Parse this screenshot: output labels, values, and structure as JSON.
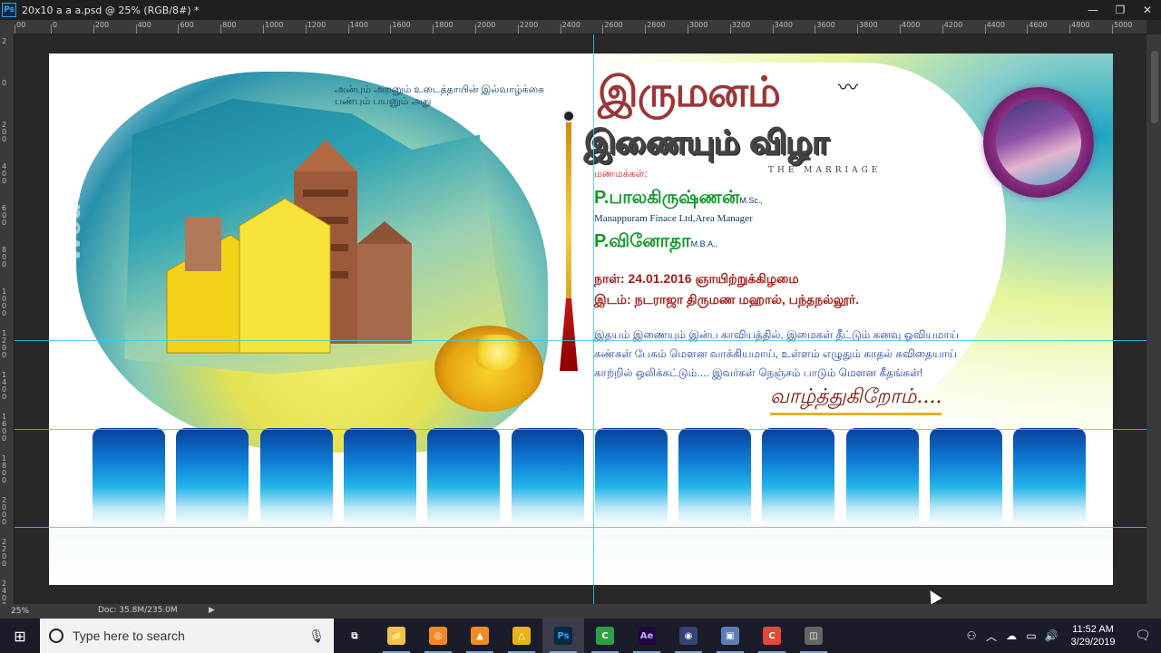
{
  "window": {
    "title": "20x10  a a a.psd @ 25% (RGB/8#) *",
    "app_icon": "Ps",
    "controls": [
      "—",
      "❐",
      "✕"
    ]
  },
  "ruler": {
    "top_labels": [
      "00",
      "0",
      "200",
      "400",
      "600",
      "800",
      "1000",
      "1200",
      "1400",
      "1600",
      "1800",
      "2000",
      "2200",
      "2400",
      "2600",
      "2800",
      "3000",
      "3200",
      "3400",
      "3600",
      "3800",
      "4000",
      "4200",
      "4400",
      "4600",
      "4800",
      "5000"
    ],
    "left_labels": [
      "2",
      "0",
      "2 0 0",
      "4 0 0",
      "6 0 0",
      "8 0 0",
      "1 0 0 0",
      "1 2 0 0",
      "1 4 0 0",
      "1 6 0 0",
      "1 8 0 0",
      "2 0 0 0",
      "2 2 0 0",
      "2 4 0 0"
    ]
  },
  "artwork": {
    "quote_line1": "அன்பும் அறனும் உடைத்தாயின் இல்வாழ்க்கை",
    "quote_line2": "பண்பும் பயனும் அது",
    "side_text": "Wedding WISHES",
    "title_back": "இருமனம்",
    "title_main": "இணையும் விழா",
    "subtitle": "THE MARRIAGE",
    "couple_label": "மணமக்கள்:",
    "groom_name": "P.பாலகிருஷ்ணன்",
    "groom_degree": "M.Sc.,",
    "groom_job": "Manappuram Finace Ltd,Area Manager",
    "bride_name": "P.வினோதா",
    "bride_degree": "M.B.A.,",
    "date_line": "நாள்: 24.01.2016 ஞாயிற்றுக்கிழமை",
    "venue_line": "இடம்: நடராஜா திருமண மஹால், பந்தநல்லூர்.",
    "poem_line1": "இதயம் இணையும் இன்ப காவியத்தில், இமைகள் தீட்டும் கனவு ஓவியமாய்",
    "poem_line2": "கண்கள் பேசும் மௌன வாக்கியமாய், உள்ளம் எழுதும் காதல் கவிதையாய்",
    "poem_line3": "காற்றில் ஒலிக்கட்டும்.... இவர்கள் நெஞ்சம் பாடும் மௌன கீதங்கள்!",
    "greeting": "வாழ்த்துகிறோம்....",
    "tile_count": 12,
    "colors": {
      "title_red": "#c0201f",
      "name_green": "#139a2b",
      "poem_blue": "#1a3fa3",
      "guide": "#2fd0e8"
    }
  },
  "status": {
    "zoom": "25%",
    "doc": "Doc: 35.8M/235.0M"
  },
  "taskbar": {
    "search_placeholder": "Type here to search",
    "apps": [
      {
        "name": "task-view",
        "glyph": "⧉"
      },
      {
        "name": "file-explorer",
        "glyph": "📁",
        "bg": "#f2c14e"
      },
      {
        "name": "app-orange",
        "glyph": "◎",
        "bg": "#f08a24"
      },
      {
        "name": "vlc",
        "glyph": "▲",
        "bg": "#f08a24"
      },
      {
        "name": "app-yellow",
        "glyph": "△",
        "bg": "#e7b416"
      },
      {
        "name": "photoshop",
        "glyph": "Ps",
        "bg": "#0a2942",
        "fg": "#31a8ff"
      },
      {
        "name": "camtasia",
        "glyph": "C",
        "bg": "#2ea043"
      },
      {
        "name": "after-effects",
        "glyph": "Ae",
        "bg": "#1f0740",
        "fg": "#c9a8ff"
      },
      {
        "name": "app-circle",
        "glyph": "◉",
        "bg": "#334477"
      },
      {
        "name": "app-network",
        "glyph": "▣",
        "bg": "#5a7fb5"
      },
      {
        "name": "app-red",
        "glyph": "C",
        "bg": "#e04a3a"
      },
      {
        "name": "app-cube",
        "glyph": "◫",
        "bg": "#666666"
      }
    ],
    "time": "11:52 AM",
    "date": "3/29/2019"
  }
}
